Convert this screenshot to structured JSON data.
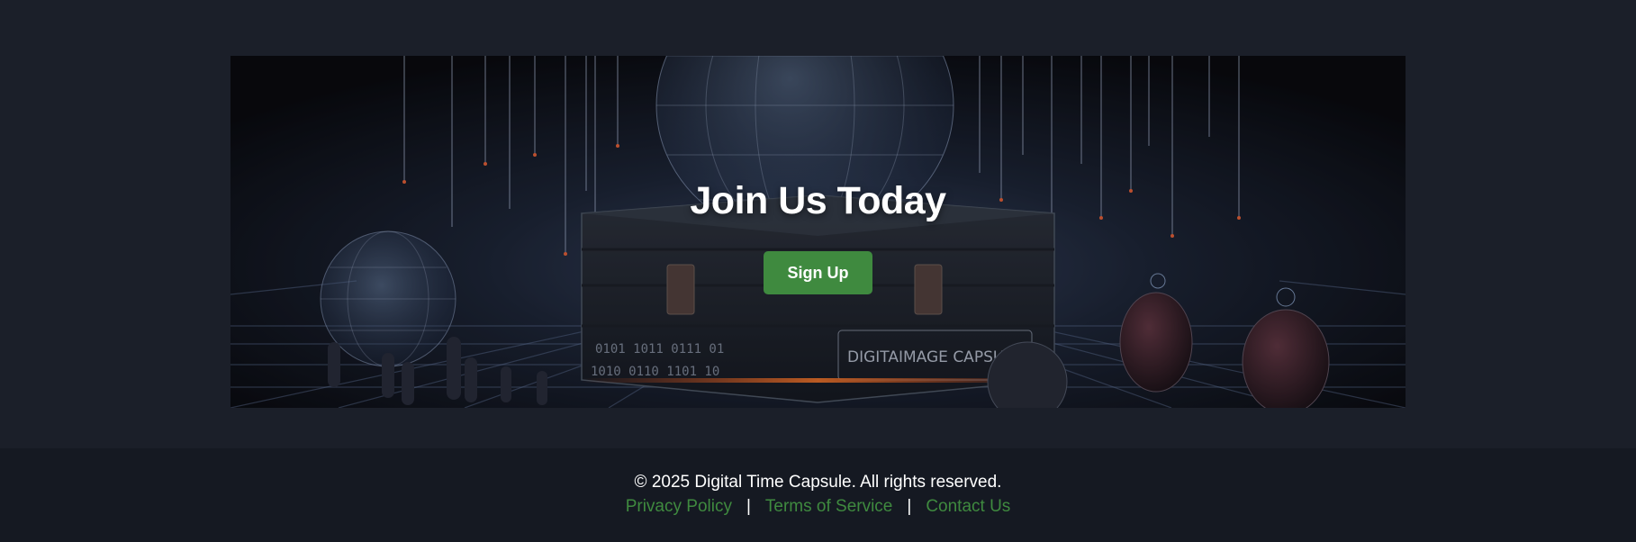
{
  "hero": {
    "title": "Join Us Today",
    "button_label": "Sign Up",
    "image_caption_text": "DIGITAIMAGE CAPSUET"
  },
  "footer": {
    "copyright": "© 2025 Digital Time Capsule. All rights reserved.",
    "links": [
      {
        "label": "Privacy Policy"
      },
      {
        "label": "Terms of Service"
      },
      {
        "label": "Contact Us"
      }
    ],
    "separator": "|"
  },
  "colors": {
    "page_background": "#1b1f29",
    "footer_background": "#151922",
    "accent_green": "#3f8a3f",
    "text_white": "#ffffff"
  }
}
